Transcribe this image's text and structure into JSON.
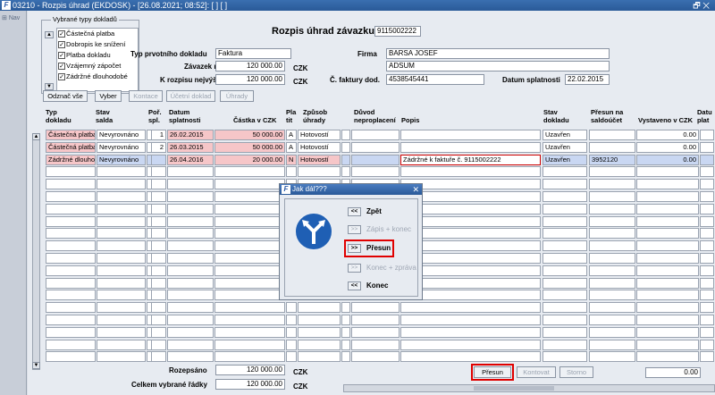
{
  "window": {
    "title": "03210 - Rozpis úhrad (EKDOSK) - [26.08.2021; 08:52]: [ ] [ ]",
    "app_icon": "F",
    "win_ctrl": "🗗 ✕"
  },
  "left_nav": {
    "label": "Nav"
  },
  "types_box": {
    "legend": "Vybrané typy dokladů",
    "items": [
      {
        "label": "Částečná platba",
        "checked": true
      },
      {
        "label": "Dobropis ke snížení",
        "checked": true
      },
      {
        "label": "Platba dokladu",
        "checked": true
      },
      {
        "label": "Vzájemný zápočet",
        "checked": true
      },
      {
        "label": "Zádržné dlouhodobé",
        "checked": true
      }
    ]
  },
  "form": {
    "heading": "Rozpis úhrad závazku č.",
    "zavazek_cislo": "9115002222",
    "typ_label": "Typ prvotního dokladu",
    "typ_value": "Faktura",
    "zavazek_label": "Závazek na",
    "zavazek_value": "120 000.00",
    "zavazek_mena": "CZK",
    "k_rozpisu_label": "K rozpisu nejvýše",
    "k_rozpisu_value": "120 000.00",
    "k_rozpisu_mena": "CZK",
    "firma_label": "Firma",
    "firma_value": "BARSA JOSEF",
    "firma_value2": "ADSUM",
    "cfaktury_label": "Č. faktury dod.",
    "cfaktury_value": "4538545441",
    "splatnost_label": "Datum splatnosti",
    "splatnost_value": "22.02.2015"
  },
  "toolbar": {
    "oznac_vse": "Odznač vše",
    "vyber": "Vyber",
    "kontace": "Kontace",
    "ucetni_doklad": "Účetní doklad",
    "uhrady": "Úhrady"
  },
  "grid": {
    "headers": {
      "typ": "Typ\ndokladu",
      "stav_salda": "Stav\nsalda",
      "por": "Poř.\nspl.",
      "datum": "Datum\nsplatnosti",
      "castka": "Částka v",
      "castka_mena": "CZK",
      "platit": "Pla\ntit",
      "zpusob": "Způsob\núhrady",
      "duvod": "Důvod\nneproplacení",
      "popis": "Popis",
      "stav_dokladu": "Stav\ndokladu",
      "presun": "Přesun na\nsaldoúčet",
      "vystaveno": "Vystaveno v",
      "vystaveno_mena": "CZK",
      "datum_platby": "Datu\nplat"
    },
    "rows": [
      {
        "typ": "Částečná platba",
        "stav": "Nevyrovnáno",
        "por": "1",
        "datum": "26.02.2015",
        "castka": "50 000.00",
        "platit": "A",
        "zpusob": "Hotovostí",
        "duvod": "",
        "popis": "",
        "stav_dokladu": "Uzavřen",
        "presun": "",
        "vystaveno": "0.00"
      },
      {
        "typ": "Částečná platba",
        "stav": "Nevyrovnáno",
        "por": "2",
        "datum": "26.03.2015",
        "castka": "50 000.00",
        "platit": "A",
        "zpusob": "Hotovostí",
        "duvod": "",
        "popis": "",
        "stav_dokladu": "Uzavřen",
        "presun": "",
        "vystaveno": "0.00"
      },
      {
        "typ": "Zádržné dlouho",
        "stav": "Nevyrovnáno",
        "por": "",
        "datum": "26.04.2016",
        "castka": "20 000.00",
        "platit": "N",
        "zpusob": "Hotovostí",
        "duvod": "",
        "popis": "Zádržné k faktuře č. 9115002222",
        "stav_dokladu": "Uzavřen",
        "presun": "3952120",
        "vystaveno": "0.00"
      }
    ]
  },
  "footer": {
    "rozepsano_label": "Rozepsáno",
    "rozepsano_value": "120 000.00",
    "rozepsano_mena": "CZK",
    "celkem_label": "Celkem vybrané řádky",
    "celkem_value": "120 000.00",
    "celkem_mena": "CZK",
    "presun_btn": "Přesun",
    "kontovat_btn": "Kontovat",
    "storno_btn": "Storno",
    "right_value": "0.00"
  },
  "dialog": {
    "title": "Jak dál???",
    "options": [
      {
        "icon": "<<",
        "label": "Zpět",
        "enabled": true
      },
      {
        "icon": ">>",
        "label": "Zápis + konec",
        "enabled": false
      },
      {
        "icon": ">>",
        "label": "Přesun",
        "enabled": true
      },
      {
        "icon": ">>",
        "label": "Konec + zpráva",
        "enabled": false
      },
      {
        "icon": "<<",
        "label": "Konec",
        "enabled": true
      }
    ]
  },
  "colors": {
    "highlight": "#e00000",
    "pink_row": "#f6c6c8",
    "selected_row": "#c9d7f2",
    "title_bar": "#2a5a98"
  }
}
